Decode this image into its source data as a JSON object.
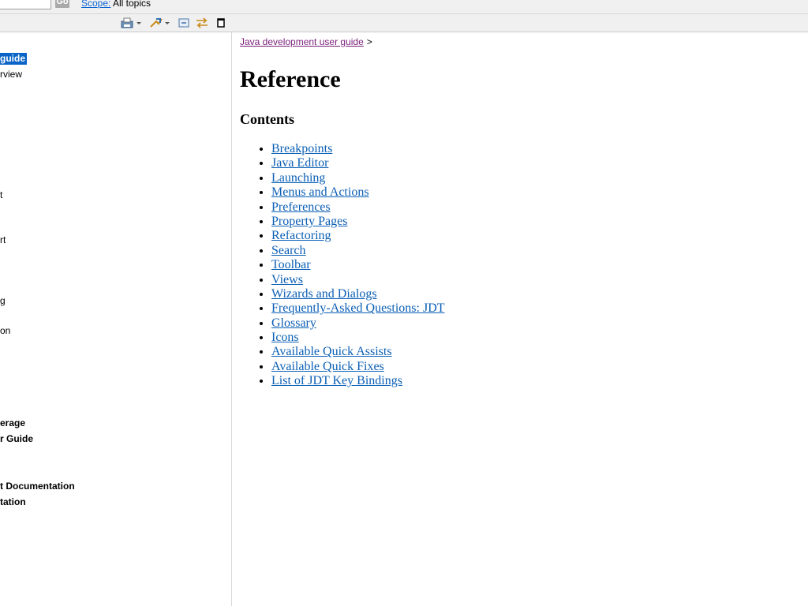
{
  "topbar": {
    "go_label": "Go",
    "scope_label": "Scope:",
    "scope_value": "All topics"
  },
  "toolbar": {
    "icons": [
      "print-icon",
      "sync-toc-icon",
      "collapse-all-icon",
      "link-with-contents-icon",
      "maximize-icon"
    ]
  },
  "tree": {
    "items": [
      {
        "label": "guide",
        "selected": true
      },
      {
        "label": "rview"
      },
      {
        "label": "t"
      },
      {
        "label": "rt"
      },
      {
        "label": "g"
      },
      {
        "label": "on"
      },
      {
        "label": "erage",
        "bold": true
      },
      {
        "label": "r Guide",
        "bold": true
      },
      {
        "label": "t Documentation",
        "bold": true
      },
      {
        "label": "tation",
        "bold": true
      }
    ]
  },
  "breadcrumb": {
    "link": "Java development user guide",
    "separator": ">"
  },
  "page": {
    "title": "Reference",
    "contents_heading": "Contents",
    "links": [
      "Breakpoints",
      "Java Editor",
      "Launching",
      "Menus and Actions",
      "Preferences",
      "Property Pages",
      "Refactoring",
      "Search",
      "Toolbar",
      "Views",
      "Wizards and Dialogs",
      "Frequently-Asked Questions: JDT",
      "Glossary",
      "Icons",
      "Available Quick Assists",
      "Available Quick Fixes",
      "List of JDT Key Bindings"
    ]
  },
  "colors": {
    "link": "#0b5fb5",
    "visited_link": "#7a1f7a",
    "selection": "#0a64c8"
  }
}
